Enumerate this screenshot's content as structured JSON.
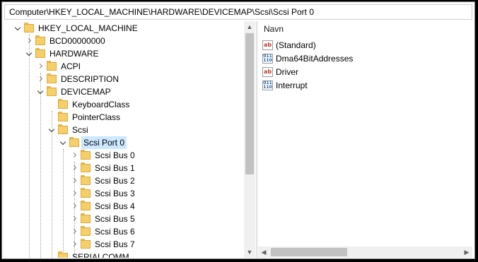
{
  "address_bar": {
    "path": "Computer\\HKEY_LOCAL_MACHINE\\HARDWARE\\DEVICEMAP\\Scsi\\Scsi Port 0"
  },
  "tree": {
    "items": [
      {
        "label": "HKEY_LOCAL_MACHINE",
        "state": "expanded"
      },
      {
        "label": "BCD00000000",
        "state": "collapsed"
      },
      {
        "label": "HARDWARE",
        "state": "expanded"
      },
      {
        "label": "ACPI",
        "state": "collapsed"
      },
      {
        "label": "DESCRIPTION",
        "state": "collapsed"
      },
      {
        "label": "DEVICEMAP",
        "state": "expanded"
      },
      {
        "label": "KeyboardClass",
        "state": "leaf"
      },
      {
        "label": "PointerClass",
        "state": "leaf"
      },
      {
        "label": "Scsi",
        "state": "expanded"
      },
      {
        "label": "Scsi Port 0",
        "state": "expanded",
        "selected": true
      },
      {
        "label": "Scsi Bus 0",
        "state": "collapsed"
      },
      {
        "label": "Scsi Bus 1",
        "state": "collapsed"
      },
      {
        "label": "Scsi Bus 2",
        "state": "collapsed"
      },
      {
        "label": "Scsi Bus 3",
        "state": "collapsed"
      },
      {
        "label": "Scsi Bus 4",
        "state": "collapsed"
      },
      {
        "label": "Scsi Bus 5",
        "state": "collapsed"
      },
      {
        "label": "Scsi Bus 6",
        "state": "collapsed"
      },
      {
        "label": "Scsi Bus 7",
        "state": "collapsed"
      },
      {
        "label": "SERIALCOMM",
        "state": "leaf"
      }
    ]
  },
  "values_pane": {
    "column_header": "Navn",
    "rows": [
      {
        "name": "(Standard)",
        "icon": "string-value-icon",
        "icon_glyph": "ab"
      },
      {
        "name": "Dma64BitAddresses",
        "icon": "binary-value-icon",
        "icon_glyph": "011\n110"
      },
      {
        "name": "Driver",
        "icon": "string-value-icon",
        "icon_glyph": "ab"
      },
      {
        "name": "Interrupt",
        "icon": "binary-value-icon",
        "icon_glyph": "011\n110"
      }
    ]
  },
  "scroll": {
    "up_glyph": "▲",
    "down_glyph": "▼",
    "left_glyph": "◀",
    "right_glyph": "▶"
  },
  "colors": {
    "selection": "#cce8ff",
    "folder": "#f6cf68",
    "string_icon": "#c0392b",
    "binary_icon": "#1f5fa8"
  }
}
